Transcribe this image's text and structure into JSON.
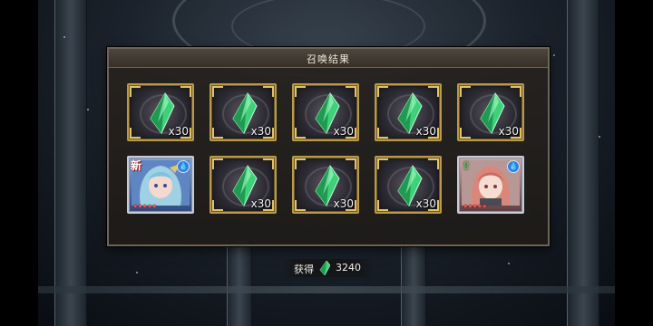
{
  "panel": {
    "title": "召唤结果"
  },
  "slots": [
    {
      "type": "crystal",
      "quantity": "x30"
    },
    {
      "type": "crystal",
      "quantity": "x30"
    },
    {
      "type": "crystal",
      "quantity": "x30"
    },
    {
      "type": "crystal",
      "quantity": "x30"
    },
    {
      "type": "crystal",
      "quantity": "x30"
    },
    {
      "type": "character",
      "new_badge": "新",
      "stars": "★★★★★",
      "element_icon": "water-drop-icon"
    },
    {
      "type": "crystal",
      "quantity": "x30"
    },
    {
      "type": "crystal",
      "quantity": "x30"
    },
    {
      "type": "crystal",
      "quantity": "x30"
    },
    {
      "type": "character",
      "upgrade_icon": "up-arrow-icon",
      "stars": "★★★★★",
      "element_icon": "water-drop-icon"
    }
  ],
  "obtained": {
    "label": "获得",
    "value": "3240",
    "icon": "green-crystal-icon"
  },
  "colors": {
    "frame_gold": "#b9994e",
    "crystal_green": "#3fd07a",
    "panel_bg": "#26221e"
  }
}
